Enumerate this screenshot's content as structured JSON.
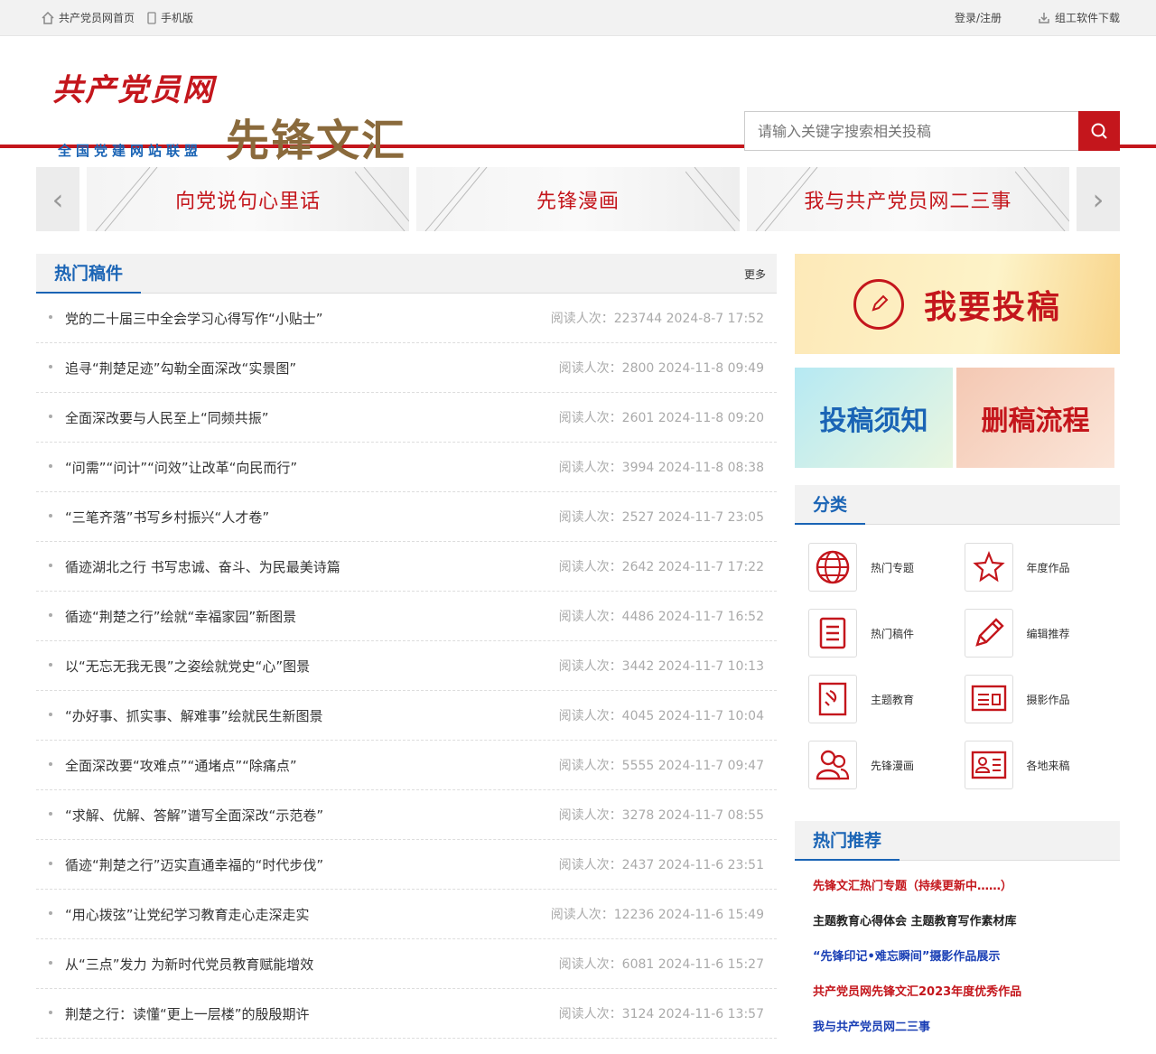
{
  "topbar": {
    "home": "共产党员网首页",
    "mobile": "手机版",
    "login": "登录/注册",
    "download": "组工软件下载"
  },
  "header": {
    "logo": "共产党员网",
    "logo_sub": "全国党建网站联盟",
    "brand": "先锋文汇"
  },
  "search": {
    "placeholder": "请输入关键字搜索相关投稿"
  },
  "banners": [
    "向党说句心里话",
    "先锋漫画",
    "我与共产党员网二三事"
  ],
  "hot_articles": {
    "title": "热门稿件",
    "more": "更多",
    "items": [
      {
        "title": "党的二十届三中全会学习心得写作“小贴士”",
        "meta": "阅读人次：223744  2024-8-7 17:52"
      },
      {
        "title": "追寻“荆楚足迹”勾勒全面深改“实景图”",
        "meta": "阅读人次：2800  2024-11-8 09:49"
      },
      {
        "title": "全面深改要与人民至上“同频共振”",
        "meta": "阅读人次：2601  2024-11-8 09:20"
      },
      {
        "title": "“问需”“问计”“问效”让改革“向民而行”",
        "meta": "阅读人次：3994  2024-11-8 08:38"
      },
      {
        "title": "“三笔齐落”书写乡村振兴“人才卷”",
        "meta": "阅读人次：2527  2024-11-7 23:05"
      },
      {
        "title": "循迹湖北之行 书写忠诚、奋斗、为民最美诗篇",
        "meta": "阅读人次：2642  2024-11-7 17:22"
      },
      {
        "title": "循迹“荆楚之行”绘就“幸福家园”新图景",
        "meta": "阅读人次：4486  2024-11-7 16:52"
      },
      {
        "title": "以“无忘无我无畏”之姿绘就党史“心”图景",
        "meta": "阅读人次：3442  2024-11-7 10:13"
      },
      {
        "title": "“办好事、抓实事、解难事”绘就民生新图景",
        "meta": "阅读人次：4045  2024-11-7 10:04"
      },
      {
        "title": "全面深改要“攻难点”“通堵点”“除痛点”",
        "meta": "阅读人次：5555  2024-11-7 09:47"
      },
      {
        "title": "“求解、优解、答解”谱写全面深改“示范卷”",
        "meta": "阅读人次：3278  2024-11-7 08:55"
      },
      {
        "title": "循迹“荆楚之行”迈实直通幸福的“时代步伐”",
        "meta": "阅读人次：2437  2024-11-6 23:51"
      },
      {
        "title": "“用心拨弦”让党纪学习教育走心走深走实",
        "meta": "阅读人次：12236  2024-11-6 15:49"
      },
      {
        "title": "从“三点”发力 为新时代党员教育赋能增效",
        "meta": "阅读人次：6081  2024-11-6 15:27"
      },
      {
        "title": "荆楚之行：读懂“更上一层楼”的殷殷期许",
        "meta": "阅读人次：3124  2024-11-6 13:57"
      }
    ]
  },
  "sidebar": {
    "submit": "我要投稿",
    "notice": "投稿须知",
    "delete_flow": "删稿流程",
    "category_title": "分类",
    "categories": [
      "热门专题",
      "年度作品",
      "热门稿件",
      "编辑推荐",
      "主题教育",
      "摄影作品",
      "先锋漫画",
      "各地来稿"
    ],
    "recommend_title": "热门推荐",
    "recommend": [
      {
        "text": "先锋文汇热门专题（持续更新中……）",
        "color": "#c4161c"
      },
      {
        "text": "主题教育心得体会 主题教育写作素材库",
        "color": "#222222"
      },
      {
        "text": "“先锋印记•难忘瞬间”摄影作品展示",
        "color": "#1a3fb5"
      },
      {
        "text": "共产党员网先锋文汇2023年度优秀作品",
        "color": "#c4161c"
      },
      {
        "text": "我与共产党员网二三事",
        "color": "#1a3fb5"
      }
    ]
  },
  "colors": {
    "accent": "#c4161c",
    "link_blue": "#1a64b5"
  }
}
